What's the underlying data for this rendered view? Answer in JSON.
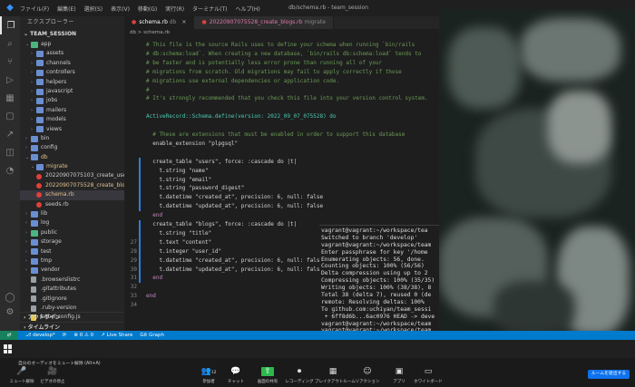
{
  "titlebar": {
    "menus": [
      "ファイル(F)",
      "編集(E)",
      "選択(S)",
      "表示(V)",
      "移動(G)",
      "実行(R)",
      "ターミナル(T)",
      "ヘルプ(H)"
    ],
    "window_title": "db/schema.rb - team_session"
  },
  "activity_icons": [
    "files-icon",
    "search-icon",
    "source-control-icon",
    "run-debug-icon",
    "extensions-icon",
    "remote-explorer-icon",
    "live-share-icon",
    "docker-icon",
    "database-icon"
  ],
  "sidebar": {
    "header": "エクスプローラー",
    "section": "TEAM_SESSION",
    "tree": [
      {
        "label": "app",
        "type": "folder",
        "color": "green",
        "depth": 1,
        "open": true
      },
      {
        "label": "assets",
        "type": "folder",
        "depth": 2
      },
      {
        "label": "channels",
        "type": "folder",
        "depth": 2
      },
      {
        "label": "controllers",
        "type": "folder",
        "depth": 2
      },
      {
        "label": "helpers",
        "type": "folder",
        "depth": 2
      },
      {
        "label": "javascript",
        "type": "folder",
        "depth": 2
      },
      {
        "label": "jobs",
        "type": "folder",
        "depth": 2
      },
      {
        "label": "mailers",
        "type": "folder",
        "depth": 2
      },
      {
        "label": "models",
        "type": "folder",
        "depth": 2
      },
      {
        "label": "views",
        "type": "folder",
        "depth": 2
      },
      {
        "label": "bin",
        "type": "folder",
        "depth": 1
      },
      {
        "label": "config",
        "type": "folder",
        "depth": 1
      },
      {
        "label": "db",
        "type": "folder",
        "depth": 1,
        "open": true,
        "mod": true
      },
      {
        "label": "migrate",
        "type": "folder",
        "depth": 2,
        "open": true,
        "mod": true
      },
      {
        "label": "20220907075103_create_use...",
        "type": "ruby",
        "depth": 3
      },
      {
        "label": "20220907075528_create_blo...",
        "type": "ruby",
        "depth": 3,
        "mod": true
      },
      {
        "label": "schema.rb",
        "type": "ruby",
        "depth": 2,
        "selected": true,
        "mod": true
      },
      {
        "label": "seeds.rb",
        "type": "ruby",
        "depth": 2
      },
      {
        "label": "lib",
        "type": "folder",
        "depth": 1
      },
      {
        "label": "log",
        "type": "folder",
        "depth": 1
      },
      {
        "label": "public",
        "type": "folder",
        "color": "green",
        "depth": 1
      },
      {
        "label": "storage",
        "type": "folder",
        "depth": 1
      },
      {
        "label": "test",
        "type": "folder",
        "depth": 1
      },
      {
        "label": "tmp",
        "type": "folder",
        "depth": 1
      },
      {
        "label": "vendor",
        "type": "folder",
        "depth": 1
      },
      {
        "label": ".browserslistrc",
        "type": "file",
        "depth": 1
      },
      {
        "label": ".gitattributes",
        "type": "file",
        "depth": 1
      },
      {
        "label": ".gitignore",
        "type": "file",
        "depth": 1
      },
      {
        "label": ".ruby-version",
        "type": "file",
        "depth": 1
      },
      {
        "label": "babel.config.js",
        "type": "js",
        "depth": 1
      }
    ],
    "bottom_sections": [
      "アウトライン",
      "タイムライン"
    ]
  },
  "tabs": [
    {
      "label": "schema.rb",
      "suffix": "db",
      "active": true
    },
    {
      "label": "20220907075528_create_blogs.rb",
      "suffix": "migrate",
      "active": false
    }
  ],
  "breadcrumb": "db > schema.rb",
  "editor_lines": [
    {
      "n": "",
      "t": "# This file is the source Rails uses to define your schema when running `bin/rails",
      "c": "comment"
    },
    {
      "n": "",
      "t": "# db:schema:load`. When creating a new database, `bin/rails db:schema:load` tends to",
      "c": "comment"
    },
    {
      "n": "",
      "t": "# be faster and is potentially less error prone than running all of your",
      "c": "comment"
    },
    {
      "n": "",
      "t": "# migrations from scratch. Old migrations may fail to apply correctly if those",
      "c": "comment"
    },
    {
      "n": "",
      "t": "# migrations use external dependencies or application code.",
      "c": "comment"
    },
    {
      "n": "",
      "t": "#",
      "c": "comment"
    },
    {
      "n": "",
      "t": "# It's strongly recommended that you check this file into your version control system.",
      "c": "comment"
    },
    {
      "n": "",
      "t": "",
      "c": ""
    },
    {
      "n": "",
      "t": "ActiveRecord::Schema.define(version: 2022_09_07_075528) do",
      "c": "def"
    },
    {
      "n": "",
      "t": "",
      "c": ""
    },
    {
      "n": "",
      "t": "  # These are extensions that must be enabled in order to support this database",
      "c": "comment"
    },
    {
      "n": "",
      "t": "  enable_extension \"plpgsql\"",
      "c": "str"
    },
    {
      "n": "",
      "t": "",
      "c": ""
    },
    {
      "n": "",
      "t": "  create_table \"users\", force: :cascade do |t|",
      "c": "str"
    },
    {
      "n": "",
      "t": "    t.string \"name\"",
      "c": "str"
    },
    {
      "n": "",
      "t": "    t.string \"email\"",
      "c": "str"
    },
    {
      "n": "",
      "t": "    t.string \"password_digest\"",
      "c": "str"
    },
    {
      "n": "",
      "t": "    t.datetime \"created_at\", precision: 6, null: false",
      "c": "str"
    },
    {
      "n": "",
      "t": "    t.datetime \"updated_at\", precision: 6, null: false",
      "c": "str"
    },
    {
      "n": "",
      "t": "  end",
      "c": "kw"
    },
    {
      "n": "",
      "t": "  create_table \"blogs\", force: :cascade do |t|",
      "c": "str"
    },
    {
      "n": "",
      "t": "    t.string \"title\"",
      "c": "str"
    },
    {
      "n": "27",
      "t": "    t.text \"content\"",
      "c": "str"
    },
    {
      "n": "28",
      "t": "    t.integer \"user_id\"",
      "c": "str"
    },
    {
      "n": "29",
      "t": "    t.datetime \"created_at\", precision: 6, null: false",
      "c": "str"
    },
    {
      "n": "30",
      "t": "    t.datetime \"updated_at\", precision: 6, null: false",
      "c": "str"
    },
    {
      "n": "31",
      "t": "  end",
      "c": "kw"
    },
    {
      "n": "32",
      "t": "",
      "c": ""
    },
    {
      "n": "33",
      "t": "end",
      "c": "kw"
    },
    {
      "n": "34",
      "t": "",
      "c": ""
    }
  ],
  "terminal_lines": [
    "vagrant@vagrant:~/workspace/tea",
    "Switched to branch 'develop'",
    "vagrant@vagrant:~/workspace/team",
    "Enter passphrase for key '/home",
    "Enumerating objects: 56, done.",
    "Counting objects: 100% (56/56)",
    "Delta compression using up to 2",
    "Compressing objects: 100% (35/35)",
    "Writing objects: 100% (38/38), 8",
    "Total 38 (delta 7), reused 0 (de",
    "remote: Resolving deltas: 100%",
    "To github.com:uchiyan/team_sessi",
    " + 6ff8d6b...6ac0976 HEAD -> deve",
    "vagrant@vagrant:~/workspace/team",
    "vagrant@vagrant:~/workspace/team"
  ],
  "statusbar": {
    "branch": "develop*",
    "sync": "⟳",
    "errors": "⊗ 0 ⚠ 0",
    "liveshare": "Live Share",
    "gitgraph": "Git Graph"
  },
  "zoom": {
    "banner": "自分のオーディオをミュート解除 (Alt+A)",
    "buttons": [
      {
        "icon": "mic-icon",
        "glyph": "🎤",
        "label": "ミュート解除"
      },
      {
        "icon": "video-icon",
        "glyph": "🎥",
        "label": "ビデオの停止"
      },
      {
        "icon": "participants-icon",
        "glyph": "👥",
        "badge": "12",
        "label": "参加者"
      },
      {
        "icon": "chat-icon",
        "glyph": "💬",
        "label": "チャット"
      },
      {
        "icon": "share-screen-icon",
        "glyph": "⇧",
        "label": "画面の共有",
        "green": true
      },
      {
        "icon": "record-icon",
        "glyph": "⏺",
        "label": "レコーディング"
      },
      {
        "icon": "breakout-icon",
        "glyph": "▦",
        "label": "ブレイクアウトルーム"
      },
      {
        "icon": "reactions-icon",
        "glyph": "☺",
        "label": "リアクション"
      },
      {
        "icon": "apps-icon",
        "glyph": "▣",
        "label": "アプリ"
      },
      {
        "icon": "whiteboard-icon",
        "glyph": "▭",
        "label": "ホワイトボード"
      }
    ],
    "leave": "ルームを退出する"
  }
}
